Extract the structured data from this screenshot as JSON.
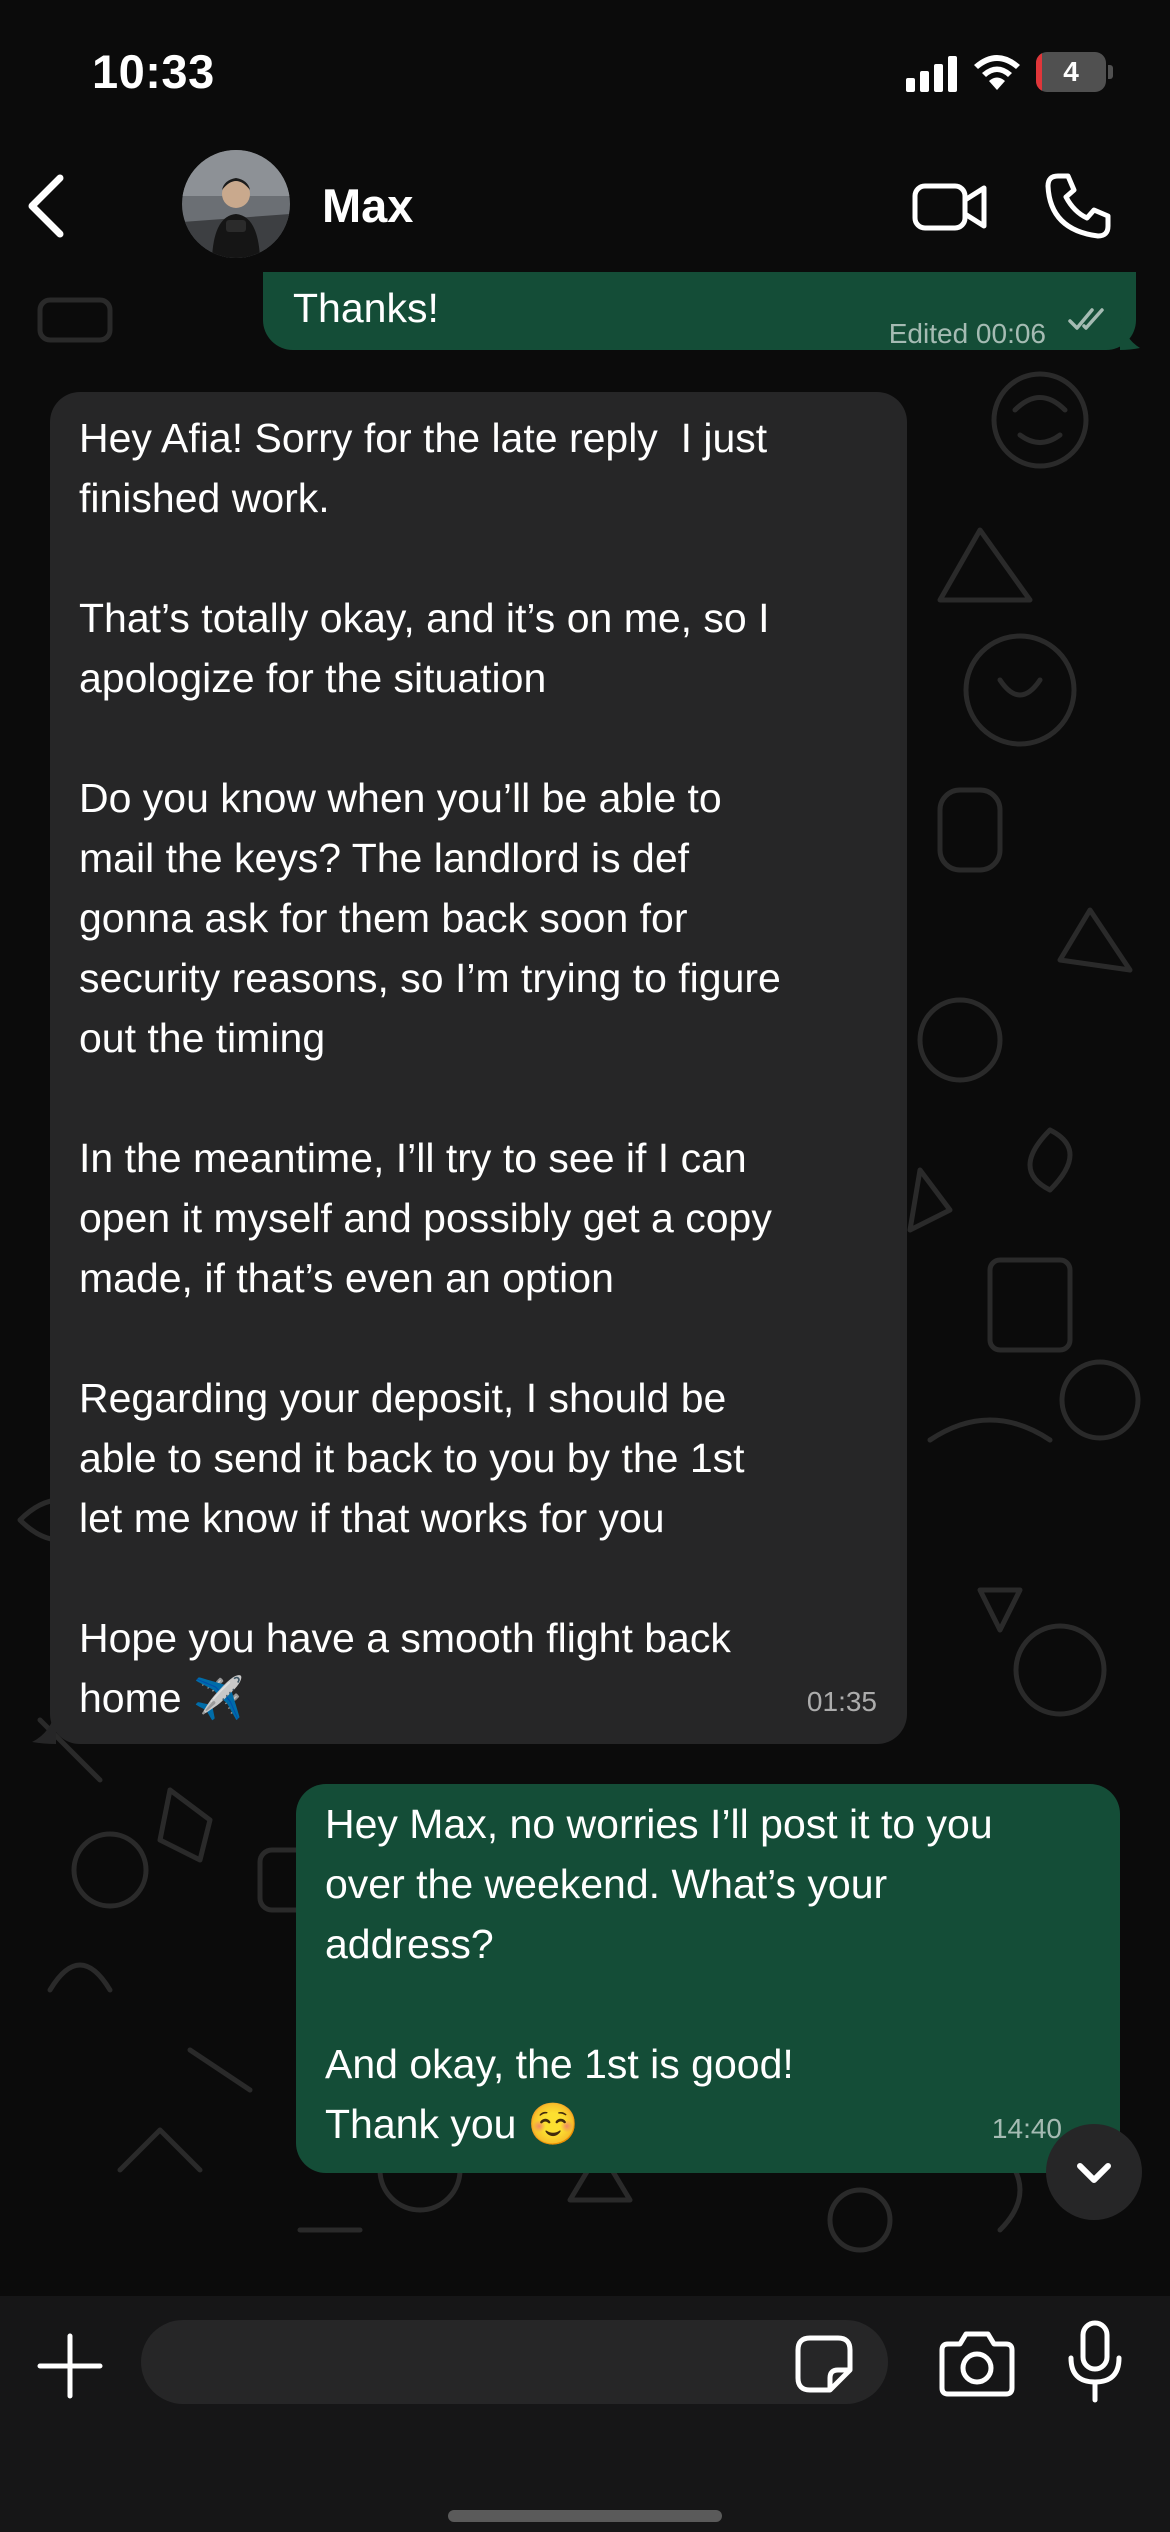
{
  "status_bar": {
    "time": "10:33",
    "battery_level": "4",
    "battery_fraction": 0.04,
    "battery_color": "#e0363a",
    "icons": [
      "signal-icon",
      "wifi-icon",
      "battery-icon"
    ]
  },
  "header": {
    "contact_name": "Max",
    "icons": [
      "chevron-left-icon",
      "avatar",
      "video-camera-icon",
      "phone-icon"
    ]
  },
  "messages": [
    {
      "direction": "outgoing",
      "text": "Thanks!",
      "meta": "Edited 00:06",
      "status": "read"
    },
    {
      "direction": "incoming",
      "text": "Hey Afia! Sorry for the late reply  I just\nfinished work.\n\nThat’s totally okay, and it’s on me, so I\napologize for the situation\n\nDo you know when you’ll be able to\nmail the keys? The landlord is def\ngonna ask for them back soon for\nsecurity reasons, so I’m trying to figure\nout the timing\n\nIn the meantime, I’ll try to see if I can\nopen it myself and possibly get a copy\nmade, if that’s even an option\n\nRegarding your deposit, I should be\nable to send it back to you by the 1st\nlet me know if that works for you\n\nHope you have a smooth flight back\nhome ✈️",
      "meta": "01:35"
    },
    {
      "direction": "outgoing",
      "text": "Hey Max, no worries I’ll post it to you\nover the weekend. What’s your\naddress?\n\nAnd okay, the 1st is good!\nThank you ☺️",
      "meta": "14:40"
    }
  ],
  "composer": {
    "placeholder": "",
    "icons": [
      "plus-icon",
      "sticker-icon",
      "camera-icon",
      "microphone-icon"
    ]
  },
  "colors": {
    "outgoing_bubble": "#144d37",
    "incoming_bubble": "#262627",
    "background": "#0b0b0b",
    "input_bar": "#161617"
  }
}
